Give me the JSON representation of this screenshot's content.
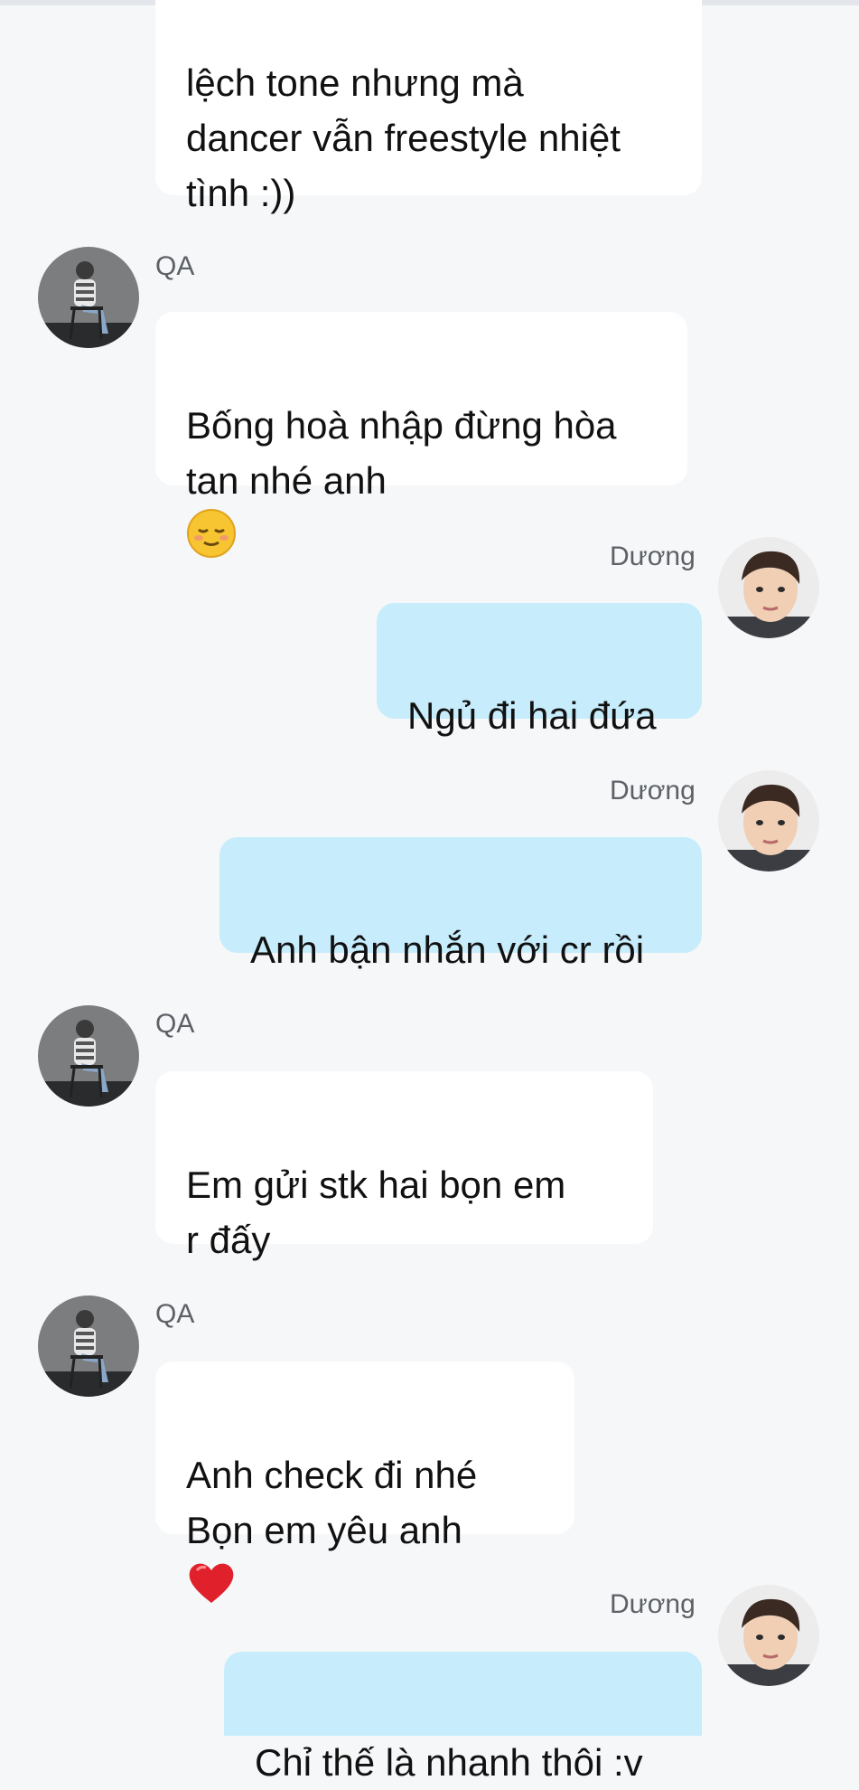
{
  "messages": [
    {
      "sender": "",
      "direction": "in",
      "text": "lệch tone nhưng mà\ndancer vẫn freestyle nhiệt\ntình :))"
    },
    {
      "sender": "QA",
      "direction": "in",
      "text": "Bống hoà nhập đừng hòa\ntan nhé anh",
      "emoji": "relieved-face-emoji"
    },
    {
      "sender": "Dương",
      "direction": "out",
      "text": "Ngủ đi hai đứa"
    },
    {
      "sender": "Dương",
      "direction": "out",
      "text": "Anh bận nhắn với cr rồi"
    },
    {
      "sender": "QA",
      "direction": "in",
      "text": "Em gửi stk hai bọn em\nr đấy"
    },
    {
      "sender": "QA",
      "direction": "in",
      "text": "Anh check đi nhé\nBọn em yêu anh",
      "emoji": "red-heart-emoji"
    },
    {
      "sender": "Dương",
      "direction": "out",
      "text": "Chỉ thế là nhanh thôi :v"
    }
  ],
  "colors": {
    "background": "#f5f7f9",
    "incoming_bubble": "#ffffff",
    "outgoing_bubble": "#c7ecfb",
    "sender_name": "#5d6166"
  }
}
